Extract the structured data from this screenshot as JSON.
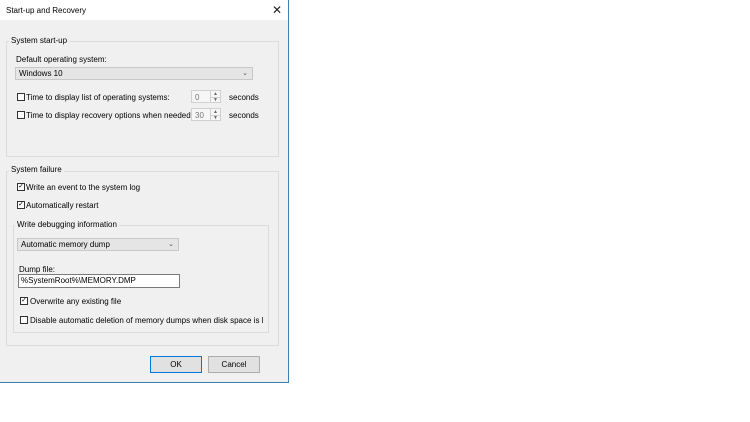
{
  "window": {
    "title": "Start-up and Recovery",
    "close_glyph": "✕"
  },
  "startup": {
    "group_label": "System start-up",
    "default_os_label": "Default operating system:",
    "default_os_value": "Windows 10",
    "time_list_label": "Time to display list of operating systems:",
    "time_list_value": "0",
    "time_list_checked": false,
    "time_recovery_label": "Time to display recovery options when needed:",
    "time_recovery_value": "30",
    "time_recovery_checked": false,
    "seconds_label": "seconds"
  },
  "failure": {
    "group_label": "System failure",
    "write_event_label": "Write an event to the system log",
    "write_event_checked": true,
    "auto_restart_label": "Automatically restart",
    "auto_restart_checked": true,
    "debug": {
      "group_label": "Write debugging information",
      "dump_type_value": "Automatic memory dump",
      "dump_file_label": "Dump file:",
      "dump_file_value": "%SystemRoot%\\MEMORY.DMP",
      "overwrite_label": "Overwrite any existing file",
      "overwrite_checked": true,
      "disable_deletion_label": "Disable automatic deletion of memory dumps when disk space is lo",
      "disable_deletion_checked": false
    }
  },
  "footer": {
    "ok_label": "OK",
    "cancel_label": "Cancel"
  },
  "icons": {
    "check": "✓",
    "dropdown": "⌄",
    "spin_up": "▲",
    "spin_down": "▼"
  }
}
